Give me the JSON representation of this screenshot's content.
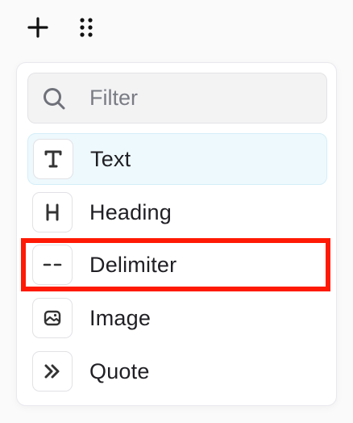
{
  "toolbar": {
    "add_icon": "plus-icon",
    "drag_icon": "drag-handle-icon"
  },
  "search": {
    "placeholder": "Filter",
    "value": "",
    "icon": "search-icon"
  },
  "menu": {
    "items": [
      {
        "label": "Text",
        "icon": "text-icon",
        "active": true
      },
      {
        "label": "Heading",
        "icon": "heading-icon",
        "active": false
      },
      {
        "label": "Delimiter",
        "icon": "delimiter-icon",
        "active": false,
        "highlighted": true
      },
      {
        "label": "Image",
        "icon": "image-icon",
        "active": false
      },
      {
        "label": "Quote",
        "icon": "quote-icon",
        "active": false
      }
    ]
  },
  "colors": {
    "active_bg": "#eef9fd",
    "highlight": "#ff1a05",
    "text": "#1f1f24",
    "placeholder": "#7a7c85"
  }
}
